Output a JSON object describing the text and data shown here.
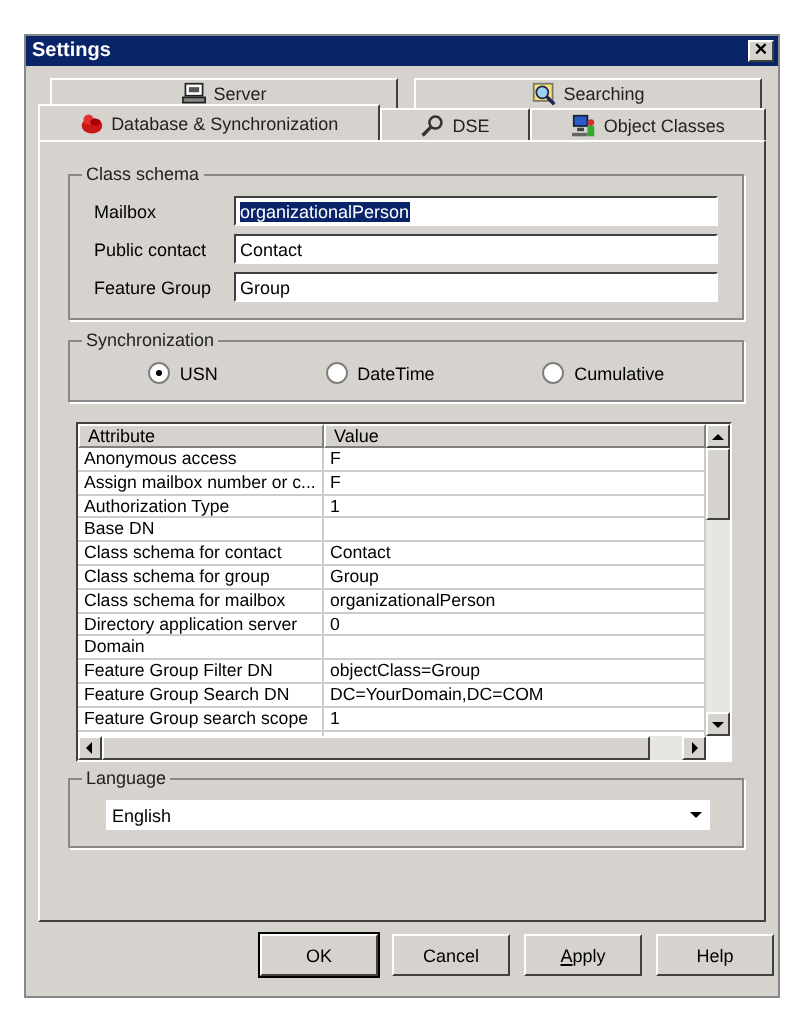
{
  "window": {
    "title": "Settings",
    "close": "×"
  },
  "tab_rows": [
    {
      "tabs": [
        {
          "label": "Server",
          "selected": false
        },
        {
          "label": "Searching",
          "selected": false
        }
      ]
    },
    {
      "tabs": [
        {
          "label": "Database & Synchronization",
          "selected": true
        },
        {
          "label": "DSE",
          "selected": false
        },
        {
          "label": "Object Classes",
          "selected": false
        }
      ]
    }
  ],
  "class_schema": {
    "title": "Class schema",
    "fields": [
      {
        "label": "Mailbox",
        "value": "organizationalPerson",
        "selected": true
      },
      {
        "label": "Public contact",
        "value": "Contact",
        "selected": false
      },
      {
        "label": "Feature Group",
        "value": "Group",
        "selected": false
      }
    ]
  },
  "synchronization": {
    "title": "Synchronization",
    "options": [
      {
        "label": "USN",
        "selected": true
      },
      {
        "label": "DateTime",
        "selected": false
      },
      {
        "label": "Cumulative",
        "selected": false
      }
    ]
  },
  "table": {
    "columns": [
      "Attribute",
      "Value"
    ],
    "rows": [
      [
        "Anonymous access",
        "F"
      ],
      [
        "Assign mailbox number or c...",
        "F"
      ],
      [
        "Authorization Type",
        "1"
      ],
      [
        "Base DN",
        ""
      ],
      [
        "Class schema for contact",
        "Contact"
      ],
      [
        "Class schema for group",
        "Group"
      ],
      [
        "Class schema for mailbox",
        "organizationalPerson"
      ],
      [
        "Directory application server",
        "0"
      ],
      [
        "Domain",
        ""
      ],
      [
        "Feature Group Filter DN",
        "objectClass=Group"
      ],
      [
        "Feature Group Search DN",
        "DC=YourDomain,DC=COM"
      ],
      [
        "Feature Group search scope",
        "1"
      ]
    ]
  },
  "language": {
    "title": "Language",
    "value": "English"
  },
  "buttons": [
    {
      "label": "OK",
      "default": true,
      "mnemonic": false
    },
    {
      "label": "Cancel",
      "default": false,
      "mnemonic": false
    },
    {
      "label": "Apply",
      "default": false,
      "mnemonic": true
    },
    {
      "label": "Help",
      "default": false,
      "mnemonic": false
    }
  ]
}
